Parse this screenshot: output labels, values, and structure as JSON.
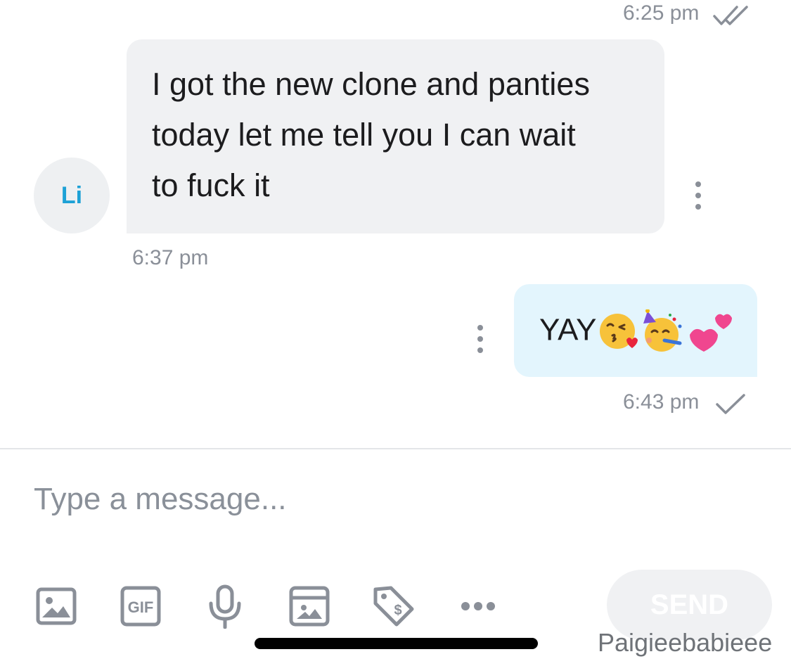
{
  "messages": [
    {
      "direction": "outgoing",
      "timestamp": "6:25 pm",
      "status_icon": "double-check-icon"
    },
    {
      "direction": "incoming",
      "avatar_initials": "Li",
      "text_lines": [
        "I got the new clone and panties",
        "today let me tell you I can wait",
        "to fuck it"
      ],
      "timestamp": "6:37 pm"
    },
    {
      "direction": "outgoing",
      "text": "YAY",
      "emojis": [
        "kissing-face-heart-emoji",
        "partying-face-emoji",
        "two-hearts-emoji"
      ],
      "timestamp": "6:43 pm",
      "status_icon": "single-check-icon"
    }
  ],
  "composer": {
    "placeholder": "Type a message...",
    "value": "",
    "send_label": "SEND",
    "tools": [
      "image-icon",
      "gif-icon",
      "microphone-icon",
      "media-vault-icon",
      "price-tag-icon",
      "more-icon"
    ]
  },
  "watermark": "Paigieebabieee",
  "colors": {
    "incoming_bubble": "#f0f1f3",
    "outgoing_bubble": "#e3f5fd",
    "avatar_text": "#1da1d6",
    "muted_text": "#8a8f98"
  }
}
